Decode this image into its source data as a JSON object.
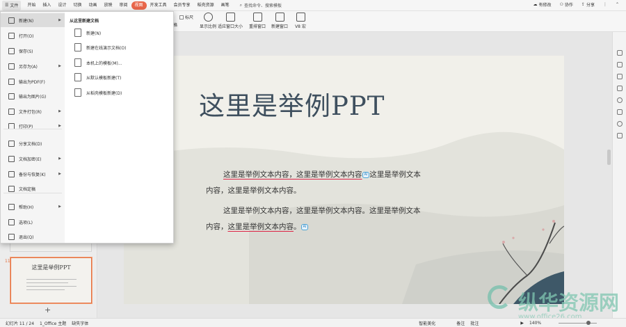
{
  "menubar": {
    "file": "文件",
    "tabs": [
      "开始",
      "插入",
      "设计",
      "切换",
      "动画",
      "放映",
      "审阅",
      "视图",
      "开发工具",
      "会员专享",
      "稻壳资源",
      "画笔"
    ],
    "active_tab": "视图",
    "search": "查找命令、搜索模板",
    "right": {
      "unsync": "有修改",
      "collab": "协作",
      "share": "分享"
    }
  },
  "ribbon": {
    "ruler": "标尺",
    "grid_suffix": "格",
    "buttons": [
      "显示比例",
      "适应窗口大小",
      "重排窗口",
      "新建窗口",
      "V8 宏"
    ]
  },
  "file_menu": {
    "items": [
      "新建(N)",
      "打开(O)",
      "保存(S)",
      "另存为(A)",
      "输出为PDF(F)",
      "输出为图片(G)",
      "文件打包(R)",
      "打印(P)",
      "分享文档(D)",
      "文档加密(E)",
      "备份与恢复(K)",
      "文档定稿",
      "帮助(H)",
      "选项(L)",
      "退出(Q)"
    ],
    "arrows": [
      "新建(N)",
      "另存为(A)",
      "文件打包(R)",
      "打印(P)",
      "文档加密(E)",
      "备份与恢复(K)",
      "帮助(H)"
    ],
    "header": "从这里新建文档",
    "sub_items": [
      "新建(N)",
      "新建在线演示文档(O)",
      "本机上的模板(M)...",
      "从默认模板新建(T)",
      "从稻壳模板新建(D)"
    ]
  },
  "slide": {
    "title": "这里是举例PPT",
    "para1_a": "这里是举例文本内容，这里是举例文本内容",
    "para1_b": "这里是举例文本内容，这里是举例文本内容。",
    "para2_a": "这里是举例文本内容，这里是举例文本内容。这里是举例文本内容，",
    "para2_b": "这里是举例文本内容",
    "para2_c": "。",
    "tag": "AI"
  },
  "thumbnail": {
    "number": "11",
    "title": "这里是举例PPT"
  },
  "statusbar": {
    "slide_info": "幻灯片 11 / 24",
    "theme": "1_Office 主题",
    "font_missing": "缺失字体",
    "beautify": "智能美化",
    "notes": "备注",
    "comments": "批注",
    "zoom": "140%"
  },
  "watermark": {
    "text": "纵华资源网",
    "url": "www.office26.com"
  },
  "icons": [
    "menu-icon",
    "search-icon",
    "share-icon",
    "collab-icon",
    "zoom-icon",
    "fit-window-icon",
    "arrange-icon",
    "new-window-icon",
    "macro-icon"
  ],
  "colors": {
    "accent": "#e8664a",
    "title": "#3e4f5e"
  }
}
